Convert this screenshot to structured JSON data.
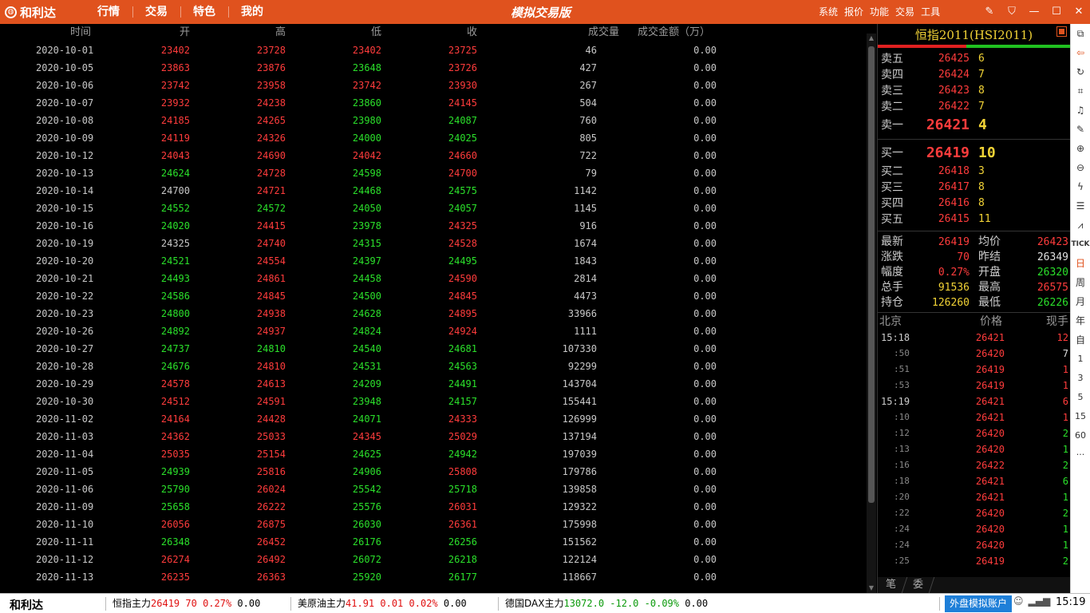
{
  "app": {
    "logo_text": "和利达",
    "title": "模拟交易版",
    "nav": [
      "行情",
      "交易",
      "特色",
      "我的"
    ],
    "sys_menu": [
      "系统",
      "报价",
      "功能",
      "交易",
      "工具"
    ],
    "window_controls": [
      "edit-icon",
      "shirt-icon",
      "minimize-icon",
      "maximize-icon",
      "close-icon"
    ]
  },
  "table": {
    "headers": {
      "date": "时间",
      "open": "开",
      "high": "高",
      "low": "低",
      "close": "收",
      "volume": "成交量",
      "amount": "成交金额（万）"
    },
    "rows": [
      {
        "date": "2020-10-01",
        "open": "23402",
        "high": "23728",
        "low": "23402",
        "close": "23725",
        "volume": "46",
        "amount": "0.00",
        "c": [
          "up",
          "up",
          "up",
          "up"
        ]
      },
      {
        "date": "2020-10-05",
        "open": "23863",
        "high": "23876",
        "low": "23648",
        "close": "23726",
        "volume": "427",
        "amount": "0.00",
        "c": [
          "up",
          "up",
          "down",
          "up"
        ]
      },
      {
        "date": "2020-10-06",
        "open": "23742",
        "high": "23958",
        "low": "23742",
        "close": "23930",
        "volume": "267",
        "amount": "0.00",
        "c": [
          "up",
          "up",
          "up",
          "up"
        ]
      },
      {
        "date": "2020-10-07",
        "open": "23932",
        "high": "24238",
        "low": "23860",
        "close": "24145",
        "volume": "504",
        "amount": "0.00",
        "c": [
          "up",
          "up",
          "down",
          "up"
        ]
      },
      {
        "date": "2020-10-08",
        "open": "24185",
        "high": "24265",
        "low": "23980",
        "close": "24087",
        "volume": "760",
        "amount": "0.00",
        "c": [
          "up",
          "up",
          "down",
          "down"
        ]
      },
      {
        "date": "2020-10-09",
        "open": "24119",
        "high": "24326",
        "low": "24000",
        "close": "24025",
        "volume": "805",
        "amount": "0.00",
        "c": [
          "up",
          "up",
          "down",
          "down"
        ]
      },
      {
        "date": "2020-10-12",
        "open": "24043",
        "high": "24690",
        "low": "24042",
        "close": "24660",
        "volume": "722",
        "amount": "0.00",
        "c": [
          "up",
          "up",
          "up",
          "up"
        ]
      },
      {
        "date": "2020-10-13",
        "open": "24624",
        "high": "24728",
        "low": "24598",
        "close": "24700",
        "volume": "79",
        "amount": "0.00",
        "c": [
          "down",
          "up",
          "down",
          "up"
        ]
      },
      {
        "date": "2020-10-14",
        "open": "24700",
        "high": "24721",
        "low": "24468",
        "close": "24575",
        "volume": "1142",
        "amount": "0.00",
        "c": [
          "flat",
          "up",
          "down",
          "down"
        ]
      },
      {
        "date": "2020-10-15",
        "open": "24552",
        "high": "24572",
        "low": "24050",
        "close": "24057",
        "volume": "1145",
        "amount": "0.00",
        "c": [
          "down",
          "down",
          "down",
          "down"
        ]
      },
      {
        "date": "2020-10-16",
        "open": "24020",
        "high": "24415",
        "low": "23978",
        "close": "24325",
        "volume": "916",
        "amount": "0.00",
        "c": [
          "down",
          "up",
          "down",
          "up"
        ]
      },
      {
        "date": "2020-10-19",
        "open": "24325",
        "high": "24740",
        "low": "24315",
        "close": "24528",
        "volume": "1674",
        "amount": "0.00",
        "c": [
          "flat",
          "up",
          "down",
          "up"
        ]
      },
      {
        "date": "2020-10-20",
        "open": "24521",
        "high": "24554",
        "low": "24397",
        "close": "24495",
        "volume": "1843",
        "amount": "0.00",
        "c": [
          "down",
          "up",
          "down",
          "down"
        ]
      },
      {
        "date": "2020-10-21",
        "open": "24493",
        "high": "24861",
        "low": "24458",
        "close": "24590",
        "volume": "2814",
        "amount": "0.00",
        "c": [
          "down",
          "up",
          "down",
          "up"
        ]
      },
      {
        "date": "2020-10-22",
        "open": "24586",
        "high": "24845",
        "low": "24500",
        "close": "24845",
        "volume": "4473",
        "amount": "0.00",
        "c": [
          "down",
          "up",
          "down",
          "up"
        ]
      },
      {
        "date": "2020-10-23",
        "open": "24800",
        "high": "24938",
        "low": "24628",
        "close": "24895",
        "volume": "33966",
        "amount": "0.00",
        "c": [
          "down",
          "up",
          "down",
          "up"
        ]
      },
      {
        "date": "2020-10-26",
        "open": "24892",
        "high": "24937",
        "low": "24824",
        "close": "24924",
        "volume": "1111",
        "amount": "0.00",
        "c": [
          "down",
          "up",
          "down",
          "up"
        ]
      },
      {
        "date": "2020-10-27",
        "open": "24737",
        "high": "24810",
        "low": "24540",
        "close": "24681",
        "volume": "107330",
        "amount": "0.00",
        "c": [
          "down",
          "down",
          "down",
          "down"
        ]
      },
      {
        "date": "2020-10-28",
        "open": "24676",
        "high": "24810",
        "low": "24531",
        "close": "24563",
        "volume": "92299",
        "amount": "0.00",
        "c": [
          "down",
          "up",
          "down",
          "down"
        ]
      },
      {
        "date": "2020-10-29",
        "open": "24578",
        "high": "24613",
        "low": "24209",
        "close": "24491",
        "volume": "143704",
        "amount": "0.00",
        "c": [
          "up",
          "up",
          "down",
          "down"
        ]
      },
      {
        "date": "2020-10-30",
        "open": "24512",
        "high": "24591",
        "low": "23948",
        "close": "24157",
        "volume": "155441",
        "amount": "0.00",
        "c": [
          "up",
          "up",
          "down",
          "down"
        ]
      },
      {
        "date": "2020-11-02",
        "open": "24164",
        "high": "24428",
        "low": "24071",
        "close": "24333",
        "volume": "126999",
        "amount": "0.00",
        "c": [
          "up",
          "up",
          "down",
          "up"
        ]
      },
      {
        "date": "2020-11-03",
        "open": "24362",
        "high": "25033",
        "low": "24345",
        "close": "25029",
        "volume": "137194",
        "amount": "0.00",
        "c": [
          "up",
          "up",
          "up",
          "up"
        ]
      },
      {
        "date": "2020-11-04",
        "open": "25035",
        "high": "25154",
        "low": "24625",
        "close": "24942",
        "volume": "197039",
        "amount": "0.00",
        "c": [
          "up",
          "up",
          "down",
          "down"
        ]
      },
      {
        "date": "2020-11-05",
        "open": "24939",
        "high": "25816",
        "low": "24906",
        "close": "25808",
        "volume": "179786",
        "amount": "0.00",
        "c": [
          "down",
          "up",
          "down",
          "up"
        ]
      },
      {
        "date": "2020-11-06",
        "open": "25790",
        "high": "26024",
        "low": "25542",
        "close": "25718",
        "volume": "139858",
        "amount": "0.00",
        "c": [
          "down",
          "up",
          "down",
          "down"
        ]
      },
      {
        "date": "2020-11-09",
        "open": "25658",
        "high": "26222",
        "low": "25576",
        "close": "26031",
        "volume": "129322",
        "amount": "0.00",
        "c": [
          "down",
          "up",
          "down",
          "up"
        ]
      },
      {
        "date": "2020-11-10",
        "open": "26056",
        "high": "26875",
        "low": "26030",
        "close": "26361",
        "volume": "175998",
        "amount": "0.00",
        "c": [
          "up",
          "up",
          "down",
          "up"
        ]
      },
      {
        "date": "2020-11-11",
        "open": "26348",
        "high": "26452",
        "low": "26176",
        "close": "26256",
        "volume": "151562",
        "amount": "0.00",
        "c": [
          "down",
          "up",
          "down",
          "down"
        ]
      },
      {
        "date": "2020-11-12",
        "open": "26274",
        "high": "26492",
        "low": "26072",
        "close": "26218",
        "volume": "122124",
        "amount": "0.00",
        "c": [
          "up",
          "up",
          "down",
          "down"
        ]
      },
      {
        "date": "2020-11-13",
        "open": "26235",
        "high": "26363",
        "low": "25920",
        "close": "26177",
        "volume": "118667",
        "amount": "0.00",
        "c": [
          "up",
          "up",
          "down",
          "down"
        ]
      }
    ]
  },
  "quote": {
    "title": "恒指2011(HSI2011)",
    "ratio": {
      "ask": 0.46,
      "bid": 0.54
    },
    "asks": [
      {
        "label": "卖五",
        "price": "26425",
        "vol": "6"
      },
      {
        "label": "卖四",
        "price": "26424",
        "vol": "7"
      },
      {
        "label": "卖三",
        "price": "26423",
        "vol": "8"
      },
      {
        "label": "卖二",
        "price": "26422",
        "vol": "7"
      },
      {
        "label": "卖一",
        "price": "26421",
        "vol": "4"
      }
    ],
    "bids": [
      {
        "label": "买一",
        "price": "26419",
        "vol": "10"
      },
      {
        "label": "买二",
        "price": "26418",
        "vol": "3"
      },
      {
        "label": "买三",
        "price": "26417",
        "vol": "8"
      },
      {
        "label": "买四",
        "price": "26416",
        "vol": "8"
      },
      {
        "label": "买五",
        "price": "26415",
        "vol": "11"
      }
    ],
    "stats": [
      {
        "l1": "最新",
        "v1": "26419",
        "c1": "up",
        "l2": "均价",
        "v2": "26423",
        "c2": "up"
      },
      {
        "l1": "涨跌",
        "v1": "70",
        "c1": "up",
        "l2": "昨结",
        "v2": "26349",
        "c2": "white"
      },
      {
        "l1": "幅度",
        "v1": "0.27%",
        "c1": "up",
        "l2": "开盘",
        "v2": "26320",
        "c2": "down"
      },
      {
        "l1": "总手",
        "v1": "91536",
        "c1": "yellow",
        "l2": "最高",
        "v2": "26575",
        "c2": "up"
      },
      {
        "l1": "持仓",
        "v1": "126260",
        "c1": "yellow",
        "l2": "最低",
        "v2": "26226",
        "c2": "down"
      }
    ],
    "tick_headers": {
      "time": "北京",
      "price": "价格",
      "qty": "现手"
    },
    "ticks": [
      {
        "time": "15:18",
        "sub": false,
        "price": "26421",
        "qty": "12",
        "pc": "up",
        "qc": "up"
      },
      {
        "time": ":50",
        "sub": true,
        "price": "26420",
        "qty": "7",
        "pc": "up",
        "qc": "white"
      },
      {
        "time": ":51",
        "sub": true,
        "price": "26419",
        "qty": "1",
        "pc": "up",
        "qc": "up"
      },
      {
        "time": ":53",
        "sub": true,
        "price": "26419",
        "qty": "1",
        "pc": "up",
        "qc": "up"
      },
      {
        "time": "15:19",
        "sub": false,
        "price": "26421",
        "qty": "6",
        "pc": "up",
        "qc": "up"
      },
      {
        "time": ":10",
        "sub": true,
        "price": "26421",
        "qty": "1",
        "pc": "up",
        "qc": "up"
      },
      {
        "time": ":12",
        "sub": true,
        "price": "26420",
        "qty": "2",
        "pc": "up",
        "qc": "down"
      },
      {
        "time": ":13",
        "sub": true,
        "price": "26420",
        "qty": "1",
        "pc": "up",
        "qc": "down"
      },
      {
        "time": ":16",
        "sub": true,
        "price": "26422",
        "qty": "2",
        "pc": "up",
        "qc": "down"
      },
      {
        "time": ":18",
        "sub": true,
        "price": "26421",
        "qty": "6",
        "pc": "up",
        "qc": "down"
      },
      {
        "time": ":20",
        "sub": true,
        "price": "26421",
        "qty": "1",
        "pc": "up",
        "qc": "down"
      },
      {
        "time": ":22",
        "sub": true,
        "price": "26420",
        "qty": "2",
        "pc": "up",
        "qc": "down"
      },
      {
        "time": ":24",
        "sub": true,
        "price": "26420",
        "qty": "1",
        "pc": "up",
        "qc": "down"
      },
      {
        "time": ":24",
        "sub": true,
        "price": "26420",
        "qty": "1",
        "pc": "up",
        "qc": "down"
      },
      {
        "time": ":25",
        "sub": true,
        "price": "26419",
        "qty": "2",
        "pc": "up",
        "qc": "down"
      }
    ],
    "bottom_tabs": [
      "笔",
      "委"
    ]
  },
  "toolbar": {
    "icons": [
      "window-icon",
      "back-icon",
      "refresh-icon",
      "crop-icon",
      "alert-icon",
      "pen-icon",
      "zoom-in-icon",
      "zoom-out-icon",
      "flash-icon",
      "list-icon",
      "chart-icon"
    ],
    "text_buttons": [
      {
        "label": "TICK",
        "cls": "tick"
      },
      {
        "label": "日",
        "cls": "active"
      },
      {
        "label": "周",
        "cls": ""
      },
      {
        "label": "月",
        "cls": ""
      },
      {
        "label": "年",
        "cls": ""
      },
      {
        "label": "自",
        "cls": ""
      },
      {
        "label": "1",
        "cls": "txt"
      },
      {
        "label": "3",
        "cls": "txt"
      },
      {
        "label": "5",
        "cls": "txt"
      },
      {
        "label": "15",
        "cls": "txt"
      },
      {
        "label": "60",
        "cls": "txt"
      },
      {
        "label": "···",
        "cls": "txt"
      }
    ]
  },
  "status": {
    "brand": "和利达",
    "tickers": [
      {
        "name": "恒指主力",
        "price": "26419",
        "chg": "70",
        "pct": "0.27%",
        "amt": "0.00",
        "color": "red"
      },
      {
        "name": "美原油主力",
        "price": "41.91",
        "chg": "0.01",
        "pct": "0.02%",
        "amt": "0.00",
        "color": "red"
      },
      {
        "name": "德国DAX主力",
        "price": "13072.0",
        "chg": "-12.0",
        "pct": "-0.09%",
        "amt": "0.00",
        "color": "green"
      }
    ],
    "account_button": "外盘模拟账户",
    "time": "15:19"
  },
  "colors": {
    "accent": "#e0521e",
    "up": "#ff3c3c",
    "down": "#2be02b",
    "yellow": "#f2d336"
  }
}
